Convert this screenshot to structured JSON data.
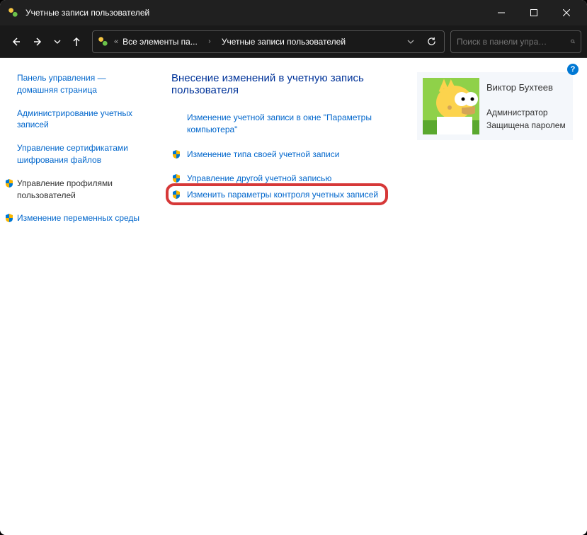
{
  "window": {
    "title": "Учетные записи пользователей"
  },
  "address": {
    "part1": "Все элементы па...",
    "part2": "Учетные записи пользователей"
  },
  "search": {
    "placeholder": "Поиск в панели упра…"
  },
  "sidebar": {
    "items": [
      {
        "label": "Панель управления — домашняя страница",
        "shield": false,
        "current": false
      },
      {
        "label": "Администрирование учетных записей",
        "shield": false,
        "current": false
      },
      {
        "label": "Управление сертификатами шифрования файлов",
        "shield": false,
        "current": false
      },
      {
        "label": "Управление профилями пользователей",
        "shield": true,
        "current": true
      },
      {
        "label": "Изменение переменных среды",
        "shield": true,
        "current": false
      }
    ]
  },
  "main": {
    "heading": "Внесение изменений в учетную запись пользователя",
    "tasks": [
      {
        "label": "Изменение учетной записи в окне \"Параметры компьютера\"",
        "shield": false
      },
      {
        "label": "Изменение типа своей учетной записи",
        "shield": true
      },
      {
        "label": "Управление другой учетной записью",
        "shield": true
      },
      {
        "label": "Изменить параметры контроля учетных записей",
        "shield": true,
        "highlighted": true
      }
    ]
  },
  "user": {
    "name": "Виктор Бухтеев",
    "role": "Администратор",
    "protection": "Защищена паролем"
  }
}
